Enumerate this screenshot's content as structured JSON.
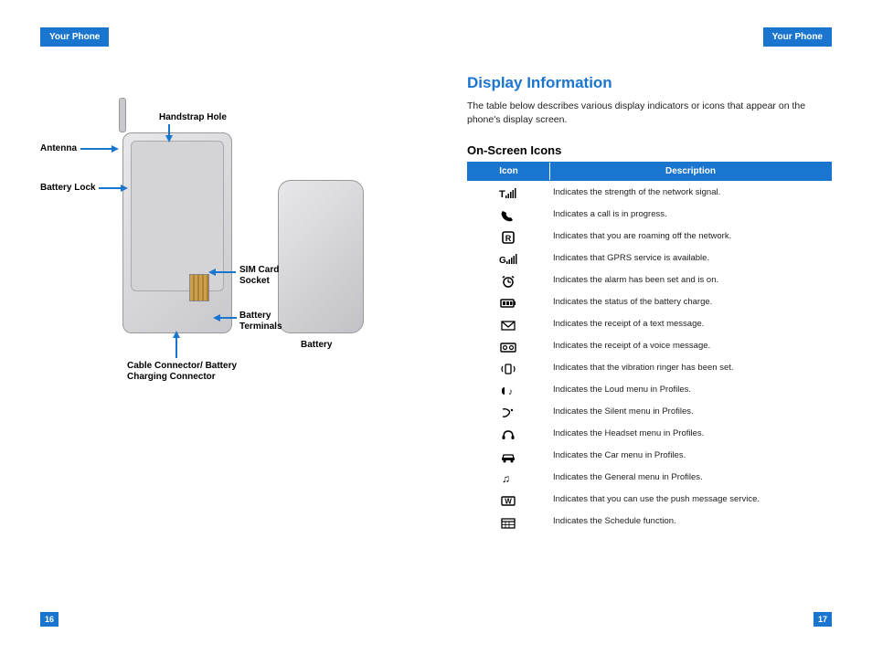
{
  "left": {
    "header": "Your Phone",
    "page_num": "16",
    "callouts": {
      "antenna": "Antenna",
      "handstrap": "Handstrap Hole",
      "battery_lock": "Battery Lock",
      "sim": "SIM Card Socket",
      "terminals": "Battery Terminals",
      "cable": "Cable Connector/ Battery Charging Connector",
      "battery": "Battery"
    }
  },
  "right": {
    "header": "Your Phone",
    "page_num": "17",
    "title": "Display Information",
    "intro": "The table below describes various display indicators or icons that appear on the phone's display screen.",
    "subtitle": "On-Screen Icons",
    "th_icon": "Icon",
    "th_desc": "Description",
    "rows": [
      {
        "icon": "signal",
        "desc": "Indicates the strength of the network signal."
      },
      {
        "icon": "call",
        "desc": "Indicates a call is in progress."
      },
      {
        "icon": "roam",
        "desc": "Indicates that you are roaming off the network."
      },
      {
        "icon": "gprs",
        "desc": "Indicates that GPRS service is available."
      },
      {
        "icon": "alarm",
        "desc": "Indicates the alarm has been set and is on."
      },
      {
        "icon": "battery",
        "desc": "Indicates the status of the battery charge."
      },
      {
        "icon": "sms",
        "desc": "Indicates the receipt of a text message."
      },
      {
        "icon": "voice",
        "desc": "Indicates the receipt of a voice message."
      },
      {
        "icon": "vibrate",
        "desc": "Indicates that the vibration ringer has been set."
      },
      {
        "icon": "loud",
        "desc": "Indicates the Loud menu in Profiles."
      },
      {
        "icon": "silent",
        "desc": "Indicates the Silent menu in Profiles."
      },
      {
        "icon": "headset",
        "desc": "Indicates the Headset menu in Profiles."
      },
      {
        "icon": "car",
        "desc": "Indicates the Car menu in Profiles."
      },
      {
        "icon": "general",
        "desc": "Indicates the General menu in Profiles."
      },
      {
        "icon": "push",
        "desc": "Indicates that you can use the push message service."
      },
      {
        "icon": "schedule",
        "desc": "Indicates the Schedule function."
      }
    ]
  }
}
